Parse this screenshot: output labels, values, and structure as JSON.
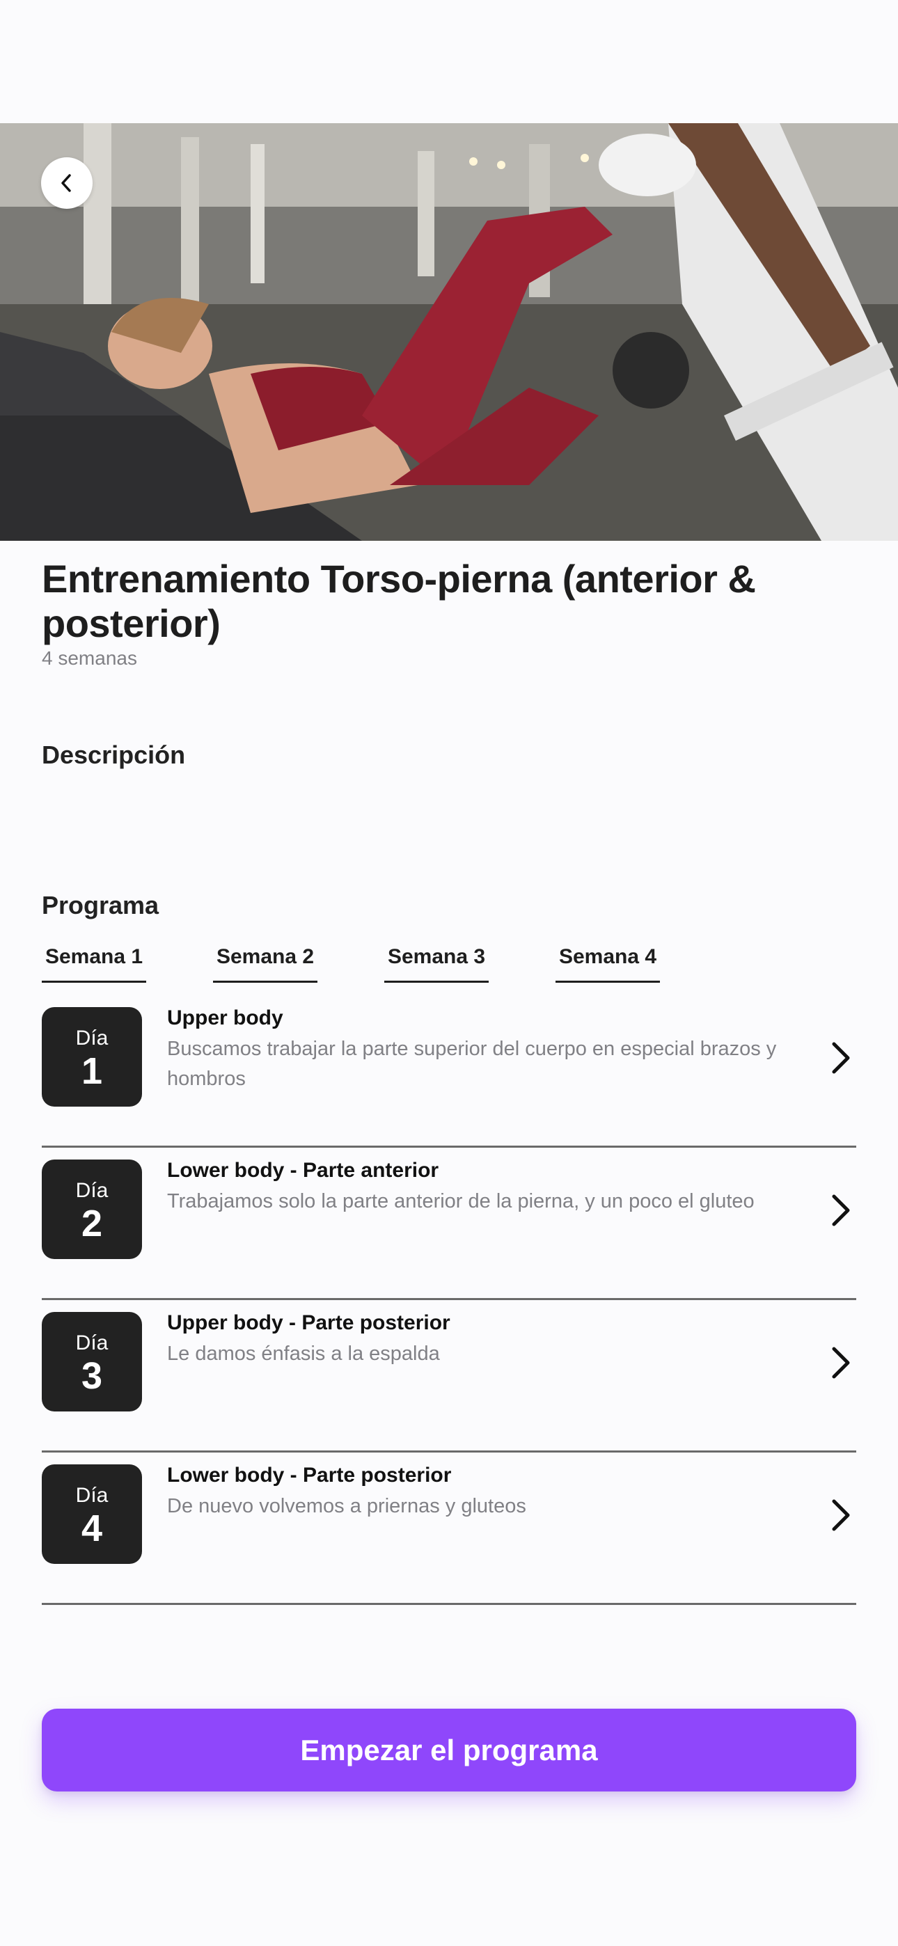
{
  "hero": {
    "image_alt": "",
    "back_icon": "chevron-left-icon"
  },
  "program": {
    "title": "Entrenamiento Torso-pierna (anterior & posterior)",
    "duration": "4 semanas"
  },
  "sections": {
    "description_heading": "Descripción",
    "program_heading": "Programa"
  },
  "tabs": [
    {
      "label": "Semana 1"
    },
    {
      "label": "Semana 2"
    },
    {
      "label": "Semana 3"
    },
    {
      "label": "Semana 4"
    }
  ],
  "days": [
    {
      "day_label": "Día",
      "number": "1",
      "title": "Upper body",
      "description": "Buscamos trabajar la parte superior del cuerpo en especial brazos y hombros"
    },
    {
      "day_label": "Día",
      "number": "2",
      "title": "Lower body - Parte anterior",
      "description": "Trabajamos solo la parte anterior de la pierna, y un poco el gluteo"
    },
    {
      "day_label": "Día",
      "number": "3",
      "title": "Upper body - Parte posterior",
      "description": "Le damos énfasis a la espalda"
    },
    {
      "day_label": "Día",
      "number": "4",
      "title": "Lower body - Parte posterior",
      "description": "De nuevo volvemos a priernas y gluteos"
    }
  ],
  "cta": {
    "label": "Empezar el programa"
  },
  "colors": {
    "accent": "#8f47fb",
    "badge_bg": "#222222",
    "muted_text": "#808085",
    "background": "#fbfbfd"
  }
}
